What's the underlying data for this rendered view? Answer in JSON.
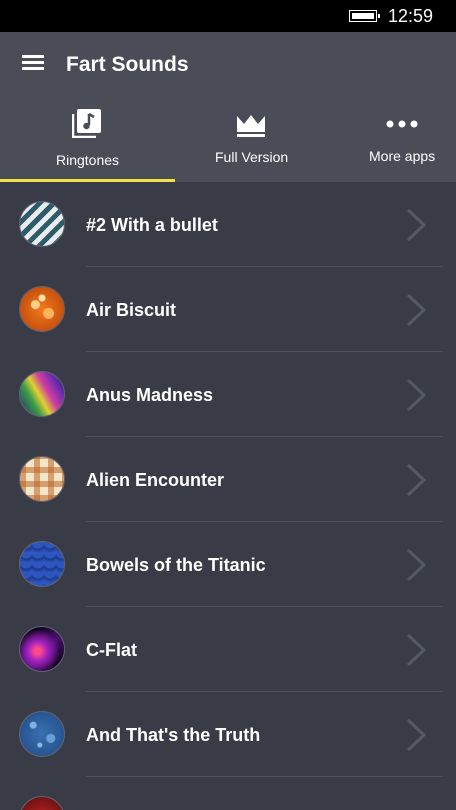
{
  "status_bar": {
    "time": "12:59"
  },
  "header": {
    "title": "Fart Sounds"
  },
  "tabs": [
    {
      "label": "Ringtones",
      "icon": "ringtones-library-icon",
      "selected": true
    },
    {
      "label": "Full Version",
      "icon": "crown-icon",
      "selected": false
    },
    {
      "label": "More apps",
      "icon": "more-dots-icon",
      "selected": false
    }
  ],
  "accent_color": "#f2e24a",
  "sounds": [
    {
      "label": "#2 With a bullet",
      "thumb": "diagonal-stripes-thumbnail"
    },
    {
      "label": "Air Biscuit",
      "thumb": "orange-bubbles-thumbnail"
    },
    {
      "label": "Anus Madness",
      "thumb": "rainbow-streaks-thumbnail"
    },
    {
      "label": "Alien Encounter",
      "thumb": "plaid-thumbnail"
    },
    {
      "label": "Bowels of the Titanic",
      "thumb": "blue-scales-thumbnail"
    },
    {
      "label": "C-Flat",
      "thumb": "purple-light-thumbnail"
    },
    {
      "label": "And That's the Truth",
      "thumb": "blue-texture-thumbnail"
    }
  ]
}
